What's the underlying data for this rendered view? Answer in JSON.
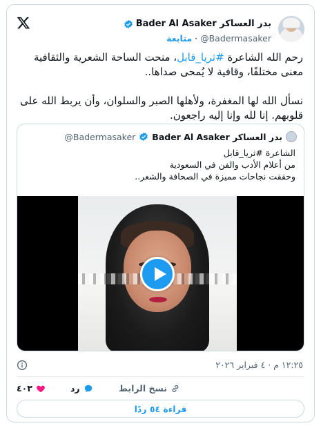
{
  "header": {
    "display_name": "بدر العساكر Bader Al Asaker",
    "handle": "@Badermasaker",
    "follow_label": "متابعة",
    "dot": "·"
  },
  "tweet": {
    "line1_a": "رحم الله الشاعرة ",
    "hashtag": "#ثريا_قابل",
    "line1_b": "، منحت الساحة الشعرية والثقافية معنى مختلفًا، وقافية لا يُمحى صداها..",
    "line2": "نسأل الله لها المغفرة، ولأهلها الصبر والسلوان، وأن يربط الله على قلوبهم. إنا لله وإنا إليه راجعون."
  },
  "quote": {
    "display_name": "بدر العساكر Bader Al Asaker",
    "handle": "@Badermasaker",
    "text": "الشاعرة #ثريا_قابل\nمن أعلام الأدب والفن في السعودية\nوحققت نجاحات مميزة في الصحافة والشعر.."
  },
  "meta": {
    "timestamp": "١٢:٢٥ م · ٤ فبراير ٢٠٢٦"
  },
  "actions": {
    "like_count": "٤٠٣",
    "reply_label": "رد",
    "copy_link_label": "نسخ الرابط"
  },
  "read_replies_label": "قراءة ٥٤ ردًا",
  "colors": {
    "accent": "#1d9bf0",
    "like": "#f91880",
    "text": "#0f1419",
    "muted": "#536471",
    "border": "#cfd9de"
  }
}
